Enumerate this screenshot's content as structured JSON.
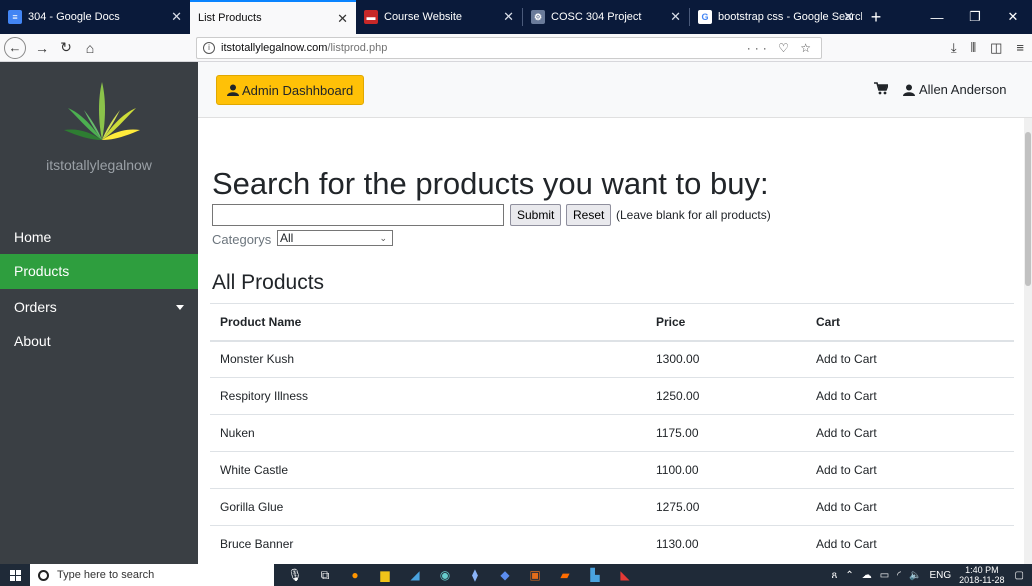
{
  "browser": {
    "tabs": [
      {
        "title": "304 - Google Docs",
        "icon": "google-docs-icon",
        "color": "#4285f4"
      },
      {
        "title": "List Products",
        "icon": "",
        "color": ""
      },
      {
        "title": "Course Website",
        "icon": "course-site-icon",
        "color": "#c62828"
      },
      {
        "title": "COSC 304 Project",
        "icon": "project-icon",
        "color": "#6a7b9a"
      },
      {
        "title": "bootstrap css - Google Search",
        "icon": "google-icon",
        "color": "#ffffff"
      }
    ],
    "active_tab": 1,
    "url_host": "itstotallylegalnow.com",
    "url_path": "/listprod.php"
  },
  "sidebar": {
    "site_name": "itstotallylegalnow",
    "items": [
      {
        "label": "Home"
      },
      {
        "label": "Products",
        "active": true
      },
      {
        "label": "Orders",
        "has_dropdown": true
      },
      {
        "label": "About"
      }
    ],
    "active_color": "#2e9e3e"
  },
  "topbar": {
    "admin_label": "Admin Dashhboard",
    "user_name": "Allen Anderson",
    "accent": "#ffc107"
  },
  "search": {
    "title": "Search for the products you want to buy:",
    "input_value": "",
    "submit_label": "Submit",
    "reset_label": "Reset",
    "hint": "(Leave blank for all products)",
    "category_label": "Categorys",
    "category_selected": "All"
  },
  "products": {
    "title": "All Products",
    "headers": [
      "Product Name",
      "Price",
      "Cart"
    ],
    "rows": [
      {
        "name": "Monster Kush",
        "price": "1300.00",
        "cart": "Add to Cart"
      },
      {
        "name": "Respitory Illness",
        "price": "1250.00",
        "cart": "Add to Cart"
      },
      {
        "name": "Nuken",
        "price": "1175.00",
        "cart": "Add to Cart"
      },
      {
        "name": "White Castle",
        "price": "1100.00",
        "cart": "Add to Cart"
      },
      {
        "name": "Gorilla Glue",
        "price": "1275.00",
        "cart": "Add to Cart"
      },
      {
        "name": "Bruce Banner",
        "price": "1130.00",
        "cart": "Add to Cart"
      }
    ]
  },
  "taskbar": {
    "search_placeholder": "Type here to search",
    "language": "ENG",
    "time": "1:40 PM",
    "date": "2018-11-28"
  }
}
